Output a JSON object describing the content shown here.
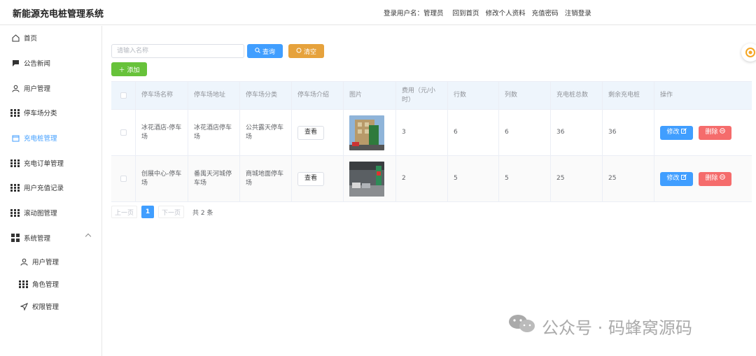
{
  "app": {
    "title": "新能源充电桩管理系统"
  },
  "topnav": {
    "user_label": "登录用户名：管理员",
    "home": "回到首页",
    "edit_profile": "修改个人资料",
    "recharge": "充值密码",
    "logout": "注销登录"
  },
  "sidebar": {
    "items": [
      {
        "label": "首页",
        "icon": "home-icon"
      },
      {
        "label": "公告新闻",
        "icon": "message-icon"
      },
      {
        "label": "用户管理",
        "icon": "user-icon"
      },
      {
        "label": "停车场分类",
        "icon": "grid-icon"
      },
      {
        "label": "充电桩管理",
        "icon": "tablet-icon",
        "active": true
      },
      {
        "label": "充电订单管理",
        "icon": "grid-icon"
      },
      {
        "label": "用户充值记录",
        "icon": "grid-icon"
      },
      {
        "label": "滚动图管理",
        "icon": "grid-icon"
      },
      {
        "label": "系统管理",
        "icon": "apps-icon",
        "expanded": true
      }
    ],
    "sub_items": [
      {
        "label": "用户管理",
        "icon": "user-icon"
      },
      {
        "label": "角色管理",
        "icon": "grid-icon"
      },
      {
        "label": "权限管理",
        "icon": "send-icon"
      }
    ]
  },
  "toolbar": {
    "search_placeholder": "请输入名称",
    "query_label": "查询",
    "clear_label": "清空",
    "add_label": "添加"
  },
  "table": {
    "columns": [
      "停车场名称",
      "停车场地址",
      "停车场分类",
      "停车场介绍",
      "图片",
      "费用（元/小时）",
      "行数",
      "列数",
      "充电桩总数",
      "剩余充电桩",
      "操作"
    ],
    "view_label": "查看",
    "edit_label": "修改",
    "delete_label": "删除",
    "rows": [
      {
        "name": "冰花酒店-停车场",
        "address": "冰花酒店停车场",
        "category": "公共露天停车场",
        "fee": "3",
        "rows": "6",
        "cols": "6",
        "total": "36",
        "remain": "36"
      },
      {
        "name": "创展中心-停车场",
        "address": "番禺天河城停车场",
        "category": "商城地面停车场",
        "fee": "2",
        "rows": "5",
        "cols": "5",
        "total": "25",
        "remain": "25"
      }
    ]
  },
  "pager": {
    "prev": "上一页",
    "page": "1",
    "next": "下一页",
    "total": "共 2 条"
  },
  "watermark": {
    "text": "公众号 · 码蜂窝源码"
  },
  "colors": {
    "primary": "#409eff",
    "warning": "#e6a23c",
    "success": "#67c23a",
    "danger": "#f56c6c"
  }
}
